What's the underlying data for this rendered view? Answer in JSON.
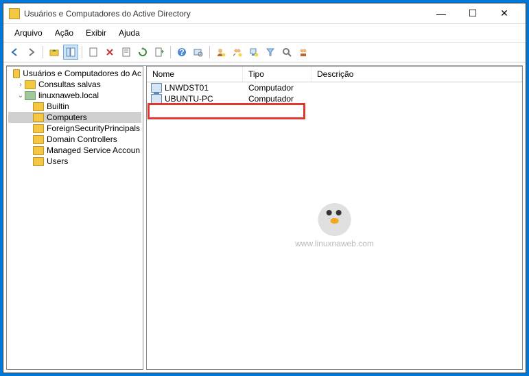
{
  "title": "Usuários e Computadores do Active Directory",
  "menu": {
    "arquivo": "Arquivo",
    "acao": "Ação",
    "exibir": "Exibir",
    "ajuda": "Ajuda"
  },
  "tree": {
    "root": "Usuários e Computadores do Ac",
    "consultas": "Consultas salvas",
    "domain": "linuxnaweb.local",
    "builtin": "Builtin",
    "computers": "Computers",
    "fsp": "ForeignSecurityPrincipals",
    "dc": "Domain Controllers",
    "msa": "Managed Service Accoun",
    "users": "Users"
  },
  "list": {
    "headers": {
      "nome": "Nome",
      "tipo": "Tipo",
      "descricao": "Descrição"
    },
    "rows": [
      {
        "name": "LNWDST01",
        "type": "Computador"
      },
      {
        "name": "UBUNTU-PC",
        "type": "Computador"
      }
    ]
  },
  "watermark": "www.linuxnaweb.com"
}
